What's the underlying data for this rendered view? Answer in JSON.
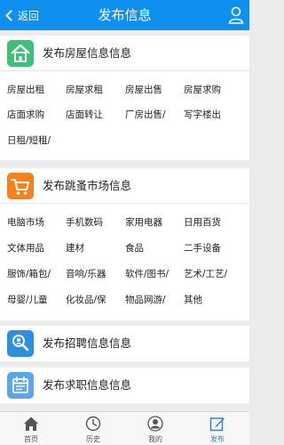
{
  "header": {
    "back_label": "返回",
    "title": "发布信息"
  },
  "sections": {
    "housing": {
      "title": "发布房屋信息信息",
      "icon": "house-icon",
      "items": [
        "房屋出租",
        "房屋求租",
        "房屋出售",
        "房屋求购",
        "店面求购",
        "店面转让",
        "厂房出售/",
        "写字楼出",
        "日租/短租/"
      ]
    },
    "flea": {
      "title": "发布跳蚤市场信息",
      "icon": "cart-icon",
      "items": [
        "电脑市场",
        "手机数码",
        "家用电器",
        "日用百货",
        "文体用品",
        "建材",
        "食品",
        "二手设备",
        "服饰/箱包/",
        "音响/乐器",
        "软件/图书/",
        "艺术/工艺/",
        "母婴/儿童",
        "化妆品/保",
        "物品网游/",
        "其他"
      ]
    },
    "jobs": {
      "title": "发布招聘信息信息",
      "icon": "search-person-icon"
    },
    "resume": {
      "title": "发布求职信息信息",
      "icon": "calendar-icon"
    }
  },
  "tabbar": {
    "items": [
      {
        "label": "首页",
        "icon": "home-icon"
      },
      {
        "label": "历史",
        "icon": "clock-icon"
      },
      {
        "label": "我的",
        "icon": "user-icon"
      },
      {
        "label": "发布",
        "icon": "edit-icon"
      }
    ],
    "active_index": 3
  },
  "colors": {
    "header_bg": "#0f8ff0",
    "house_icon_bg": "#3ec07a",
    "cart_icon_bg": "#f6821f",
    "jobs_icon_bg": "#2d8fe0",
    "resume_icon_bg": "#5aa6e8",
    "active_tab": "#3a7fd0"
  }
}
